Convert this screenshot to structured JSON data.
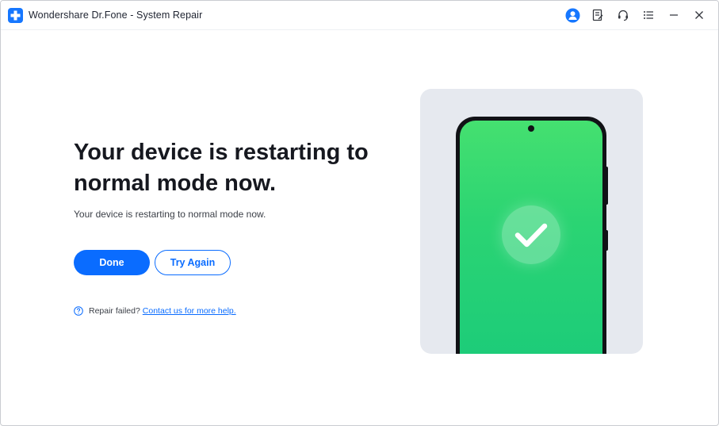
{
  "window": {
    "title": "Wondershare Dr.Fone - System Repair"
  },
  "titlebar_icons": [
    "account-icon",
    "feedback-icon",
    "support-headset-icon",
    "menu-icon",
    "minimize-icon",
    "close-icon"
  ],
  "main": {
    "headline": "Your device is restarting to normal mode now.",
    "subtext": "Your device is restarting to normal mode now.",
    "done_label": "Done",
    "try_again_label": "Try Again",
    "help_prefix": "Repair failed?",
    "help_link": "Contact us for more help."
  },
  "colors": {
    "accent": "#0a6cff",
    "success_green": "#2bd473",
    "illustration_bg": "#e6e9ef"
  }
}
